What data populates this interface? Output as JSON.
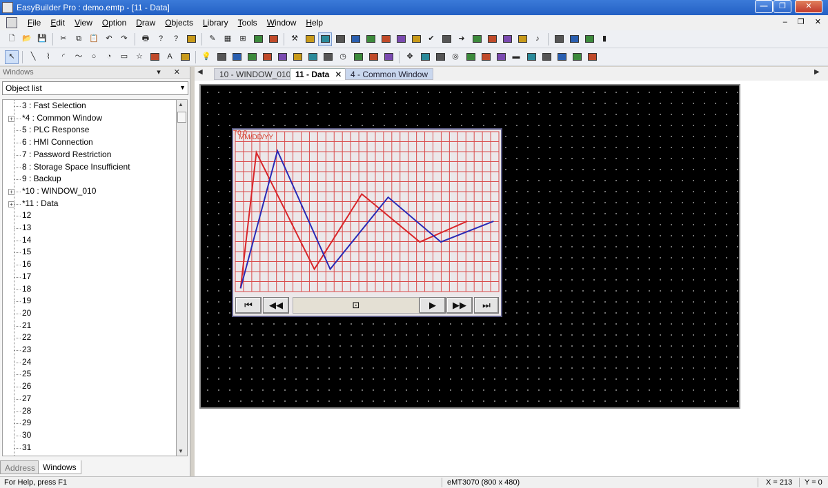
{
  "window": {
    "title": "EasyBuilder Pro : demo.emtp - [11 - Data]",
    "minimize": "—",
    "maximize": "❐",
    "close": "✕"
  },
  "menu": [
    {
      "underline": "F",
      "rest": "ile"
    },
    {
      "underline": "E",
      "rest": "dit"
    },
    {
      "underline": "V",
      "rest": "iew"
    },
    {
      "underline": "O",
      "rest": "ption"
    },
    {
      "underline": "D",
      "rest": "raw"
    },
    {
      "underline": "O",
      "rest": "bjects"
    },
    {
      "underline": "L",
      "rest": "ibrary"
    },
    {
      "underline": "T",
      "rest": "ools"
    },
    {
      "underline": "W",
      "rest": "indow"
    },
    {
      "underline": "H",
      "rest": "elp"
    }
  ],
  "mdi_controls": "– ❐ ✕",
  "left_panel": {
    "header": "Windows",
    "header_controls": "▾ ✕",
    "selector_value": "Object list",
    "tree": [
      {
        "label": "3 : Fast Selection",
        "expandable": false
      },
      {
        "label": "*4 : Common Window",
        "expandable": true
      },
      {
        "label": "5 : PLC Response",
        "expandable": false
      },
      {
        "label": "6 : HMI Connection",
        "expandable": false
      },
      {
        "label": "7 : Password Restriction",
        "expandable": false
      },
      {
        "label": "8 : Storage Space Insufficient",
        "expandable": false
      },
      {
        "label": "9 : Backup",
        "expandable": false
      },
      {
        "label": "*10 : WINDOW_010",
        "expandable": true
      },
      {
        "label": "*11 : Data",
        "expandable": true
      },
      {
        "label": "12",
        "expandable": false
      },
      {
        "label": "13",
        "expandable": false
      },
      {
        "label": "14",
        "expandable": false
      },
      {
        "label": "15",
        "expandable": false
      },
      {
        "label": "16",
        "expandable": false
      },
      {
        "label": "17",
        "expandable": false
      },
      {
        "label": "18",
        "expandable": false
      },
      {
        "label": "19",
        "expandable": false
      },
      {
        "label": "20",
        "expandable": false
      },
      {
        "label": "21",
        "expandable": false
      },
      {
        "label": "22",
        "expandable": false
      },
      {
        "label": "23",
        "expandable": false
      },
      {
        "label": "24",
        "expandable": false
      },
      {
        "label": "25",
        "expandable": false
      },
      {
        "label": "26",
        "expandable": false
      },
      {
        "label": "27",
        "expandable": false
      },
      {
        "label": "28",
        "expandable": false
      },
      {
        "label": "29",
        "expandable": false
      },
      {
        "label": "30",
        "expandable": false
      },
      {
        "label": "31",
        "expandable": false
      }
    ],
    "tabs": {
      "address": "Address",
      "windows": "Windows"
    }
  },
  "doc_tabs": {
    "left_arrow": "◀",
    "right_arrow": "▶",
    "items": [
      "10 - WINDOW_010",
      "11 - Data",
      "4 - Common Window"
    ],
    "active_index": 1,
    "close": "✕"
  },
  "trend": {
    "date_label": "MM/DD/YY",
    "index_label": "T0:0",
    "series": [
      {
        "color": "#d8262a",
        "points": [
          [
            0.02,
            0.98
          ],
          [
            0.08,
            0.13
          ],
          [
            0.3,
            0.86
          ],
          [
            0.48,
            0.39
          ],
          [
            0.7,
            0.69
          ],
          [
            0.88,
            0.56
          ]
        ]
      },
      {
        "color": "#2a2ab4",
        "points": [
          [
            0.02,
            0.98
          ],
          [
            0.16,
            0.12
          ],
          [
            0.36,
            0.86
          ],
          [
            0.58,
            0.41
          ],
          [
            0.78,
            0.69
          ],
          [
            0.98,
            0.56
          ]
        ]
      }
    ],
    "nav": {
      "first": "⏮",
      "prev": "◀◀",
      "mid": "⊡",
      "play": "▶",
      "next": "▶▶",
      "last": "⏭"
    }
  },
  "status": {
    "help": "For Help, press F1",
    "model": "eMT3070 (800 x 480)",
    "x": "X = 213",
    "y": "Y = 0"
  },
  "colors": {
    "grid": "#d94a4a",
    "screen_bg": "#000000",
    "trend_bg": "#ece8ea"
  },
  "toolbar1_icons": [
    "new-icon",
    "open-icon",
    "save-icon",
    "cut-icon",
    "copy-icon",
    "paste-icon",
    "undo-icon",
    "redo-icon",
    "print-icon",
    "help-icon",
    "context-help-icon",
    "library-icon",
    "pen-icon",
    "grid-icon",
    "align-icon",
    "window-icon",
    "overlay-icon",
    "tools-icon",
    "data-icon",
    "trend-icon",
    "history-icon",
    "3d-icon",
    "edit-icon",
    "list-icon",
    "table-icon",
    "toggle-icon",
    "check-icon",
    "tank-icon",
    "arrow-icon",
    "box-icon",
    "flag-icon",
    "stack-icon",
    "note-icon",
    "music-icon",
    "chart-icon",
    "chat-icon",
    "edit2-icon",
    "bars-icon"
  ],
  "toolbar2_icons": [
    "select-icon",
    "line-icon",
    "polyline-icon",
    "arc-icon",
    "curve-icon",
    "circle-icon",
    "ellipse-icon",
    "rectangle-icon",
    "star-icon",
    "bitmap-icon",
    "text-icon",
    "image-icon",
    "lamp-icon",
    "button-icon",
    "numeric-icon",
    "input-icon",
    "gauge-icon",
    "slider-icon",
    "meter-icon",
    "bar-icon",
    "dial-icon",
    "clock-icon",
    "clear-icon",
    "recipe-icon",
    "layout-icon",
    "move-icon",
    "calendar-icon",
    "history-graph-icon",
    "target-icon",
    "grid2-icon",
    "chart2-icon",
    "data-table-icon",
    "stop-icon",
    "message-icon",
    "form-icon",
    "mail-icon",
    "export-icon",
    "settings-icon"
  ]
}
